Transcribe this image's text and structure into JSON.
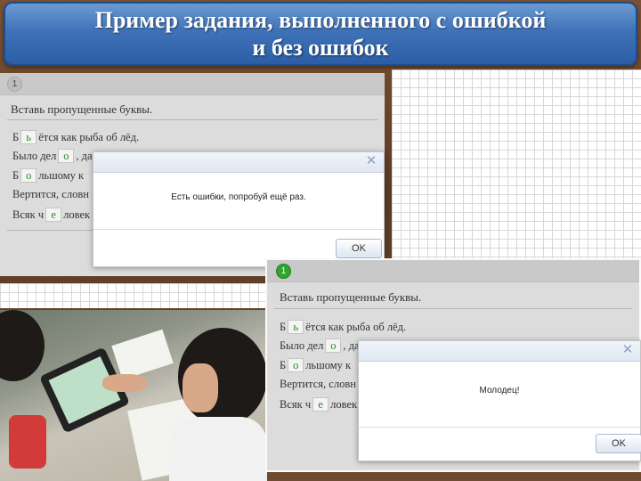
{
  "title": "Пример задания, выполненного с ошибкой\nи без ошибок",
  "exercise": {
    "step_number": "1",
    "instruction": "Вставь пропущенные буквы.",
    "lines": [
      {
        "before": "Б",
        "box": "ь",
        "after": "ётся как рыба об лёд."
      },
      {
        "before": "Было дел",
        "box": "о",
        "after": ", да"
      },
      {
        "before": "Б",
        "box": "о",
        "after": "льшому к"
      },
      {
        "before": "Вертится, словн",
        "box": "",
        "after": ""
      },
      {
        "before": "Всяк ч",
        "box": "е",
        "after": "ловек"
      }
    ]
  },
  "dialog_error": {
    "message": "Есть ошибки, попробуй ещё раз.",
    "ok_label": "OK",
    "close_icon": "close-icon"
  },
  "dialog_success": {
    "message": "Молодец!",
    "ok_label": "OK",
    "close_icon": "close-icon"
  },
  "colors": {
    "banner": "#3f72b8",
    "correct_letter": "#2d8a2d",
    "success_badge": "#2fa52f"
  }
}
